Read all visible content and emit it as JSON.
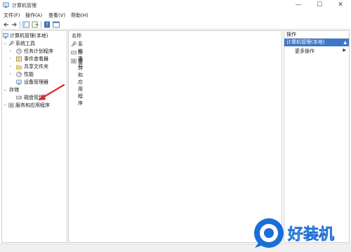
{
  "window": {
    "title": "计算机管理",
    "minimize": "—",
    "maximize": "☐",
    "close": "✕"
  },
  "menu": {
    "file": "文件(F)",
    "action": "操作(A)",
    "view": "查看(V)",
    "help": "帮助(H)"
  },
  "toolbar": {
    "back_icon": "arrow-left-icon",
    "forward_icon": "arrow-right-icon"
  },
  "tree": {
    "root": "计算机管理(本地)",
    "system_tools": "系统工具",
    "task_scheduler": "任务计划程序",
    "event_viewer": "事件查看器",
    "shared_folders": "共享文件夹",
    "performance": "性能",
    "device_manager": "设备管理器",
    "storage": "存储",
    "disk_management": "磁盘管理",
    "services_apps": "服务和应用程序"
  },
  "middle": {
    "column_name": "名称",
    "items": [
      "系统工具",
      "存储",
      "服务和应用程序"
    ]
  },
  "actions": {
    "header": "操作",
    "selected": "计算机管理(本地)",
    "more": "更多操作"
  },
  "watermark": {
    "text": "好装机"
  },
  "colors": {
    "selection": "#3c78c8",
    "arrow": "#e0282d",
    "watermark_blue": "#1a6ed8"
  }
}
